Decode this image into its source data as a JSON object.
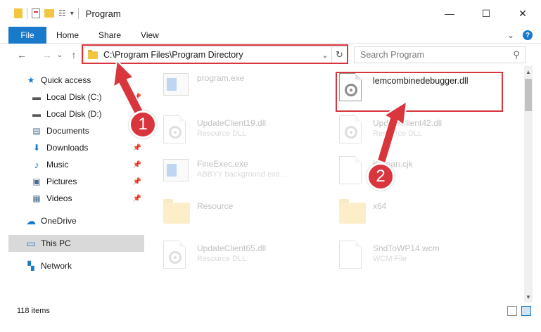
{
  "window": {
    "title": "Program",
    "minimize": "—",
    "maximize": "☐",
    "close": "✕"
  },
  "ribbon": {
    "file": "File",
    "tabs": [
      "Home",
      "Share",
      "View"
    ],
    "expand": "⌄",
    "help": "?"
  },
  "nav": {
    "back": "←",
    "forward": "→",
    "recent": "⌄",
    "up": "↑",
    "address_path": "C:\\Program Files\\Program Directory",
    "address_dropdown": "⌄",
    "refresh": "↻",
    "search_placeholder": "Search Program",
    "search_icon": "⚲"
  },
  "sidebar": {
    "items": [
      {
        "label": "Quick access",
        "icon": "star-icon",
        "glyph": "★",
        "color": "#1979ca"
      },
      {
        "label": "Local Disk (C:)",
        "icon": "drive-icon",
        "glyph": "▬",
        "color": "#555555"
      },
      {
        "label": "Local Disk (D:)",
        "icon": "drive-icon",
        "glyph": "▬",
        "color": "#555555"
      },
      {
        "label": "Documents",
        "icon": "documents-icon",
        "glyph": "▤",
        "color": "#4a6d8c"
      },
      {
        "label": "Downloads",
        "icon": "download-icon",
        "glyph": "⬇",
        "color": "#1979ca"
      },
      {
        "label": "Music",
        "icon": "music-icon",
        "glyph": "♪",
        "color": "#1979ca"
      },
      {
        "label": "Pictures",
        "icon": "pictures-icon",
        "glyph": "▣",
        "color": "#4a6d8c"
      },
      {
        "label": "Videos",
        "icon": "videos-icon",
        "glyph": "▦",
        "color": "#4a6d8c"
      },
      {
        "label": "OneDrive",
        "icon": "cloud-icon",
        "glyph": "☁",
        "color": "#1979ca"
      },
      {
        "label": "This PC",
        "icon": "computer-icon",
        "glyph": "▭",
        "color": "#1979ca"
      },
      {
        "label": "Network",
        "icon": "network-icon",
        "glyph": "▚",
        "color": "#1979ca"
      }
    ],
    "pin_glyph": "📌"
  },
  "files": [
    {
      "name": "program.exe",
      "desc": "",
      "type": "exe"
    },
    {
      "name": "lemcombinedebugger.dll",
      "desc": "",
      "type": "dll"
    },
    {
      "name": "UpdateClient19.dll",
      "desc": "Resource DLL",
      "type": "dll"
    },
    {
      "name": "UpdateClient42.dll",
      "desc": "Resource DLL",
      "type": "dll"
    },
    {
      "name": "FineExec.exe",
      "desc": "ABBYY background exe...",
      "type": "exe"
    },
    {
      "name": "Korean.cjk",
      "desc": "",
      "type": "doc"
    },
    {
      "name": "Resource",
      "desc": "",
      "type": "folder"
    },
    {
      "name": "x64",
      "desc": "",
      "type": "folder"
    },
    {
      "name": "UpdateClient65.dll",
      "desc": "Resource DLL",
      "type": "dll"
    },
    {
      "name": "SndToWP14.wcm",
      "desc": "WCM File",
      "type": "doc"
    }
  ],
  "status": {
    "item_count": "118 items"
  },
  "annotations": {
    "badge1": "1",
    "badge2": "2",
    "highlight_color": "#d8353d"
  }
}
